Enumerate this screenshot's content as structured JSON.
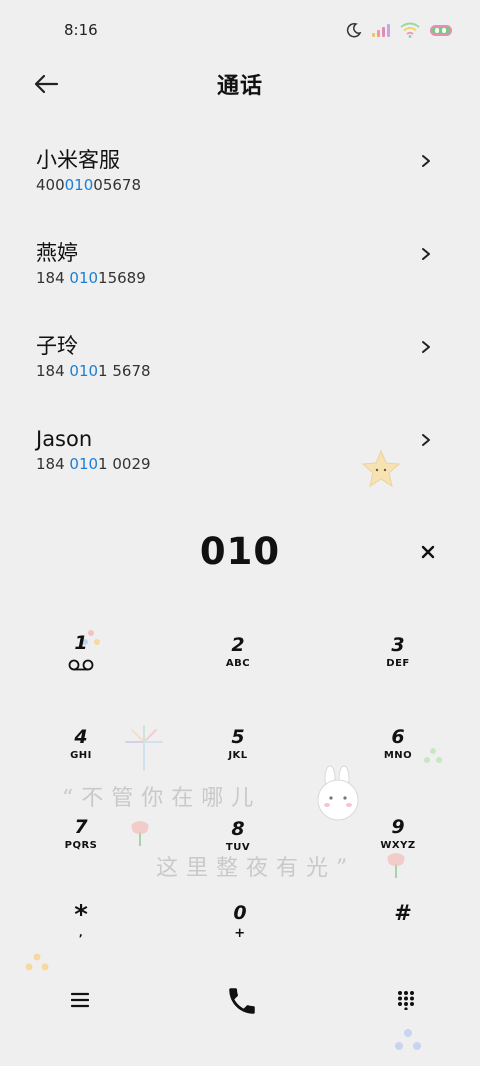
{
  "status": {
    "time": "8:16"
  },
  "header": {
    "title": "通话"
  },
  "contacts": [
    {
      "name": "小米客服",
      "number_pre": "400",
      "number_hl": "010",
      "number_post": "05678"
    },
    {
      "name": "燕婷",
      "number_pre": "184 ",
      "number_hl": "010",
      "number_post": "15689"
    },
    {
      "name": "子玲",
      "number_pre": "184 ",
      "number_hl": "010",
      "number_post": "1 5678"
    },
    {
      "name": "Jason",
      "number_pre": "184 ",
      "number_hl": "010",
      "number_post": "1 0029"
    }
  ],
  "dial": {
    "value": "010"
  },
  "keypad": [
    {
      "digit": "1",
      "letters": ""
    },
    {
      "digit": "2",
      "letters": "ABC"
    },
    {
      "digit": "3",
      "letters": "DEF"
    },
    {
      "digit": "4",
      "letters": "GHI"
    },
    {
      "digit": "5",
      "letters": "JKL"
    },
    {
      "digit": "6",
      "letters": "MNO"
    },
    {
      "digit": "7",
      "letters": "PQRS"
    },
    {
      "digit": "8",
      "letters": "TUV"
    },
    {
      "digit": "9",
      "letters": "WXYZ"
    },
    {
      "digit": "*",
      "letters": ","
    },
    {
      "digit": "0",
      "letters": "+"
    },
    {
      "digit": "#",
      "letters": ""
    }
  ],
  "wallpaper": {
    "line1": "“不管你在哪儿",
    "line2": "这里整夜有光”"
  },
  "icons": {
    "back": "arrow-left-icon",
    "chevron": "chevron-right-icon",
    "clear": "close-icon",
    "voicemail": "voicemail-icon",
    "menu": "menu-icon",
    "call": "phone-icon",
    "dialpad": "dialpad-icon"
  }
}
